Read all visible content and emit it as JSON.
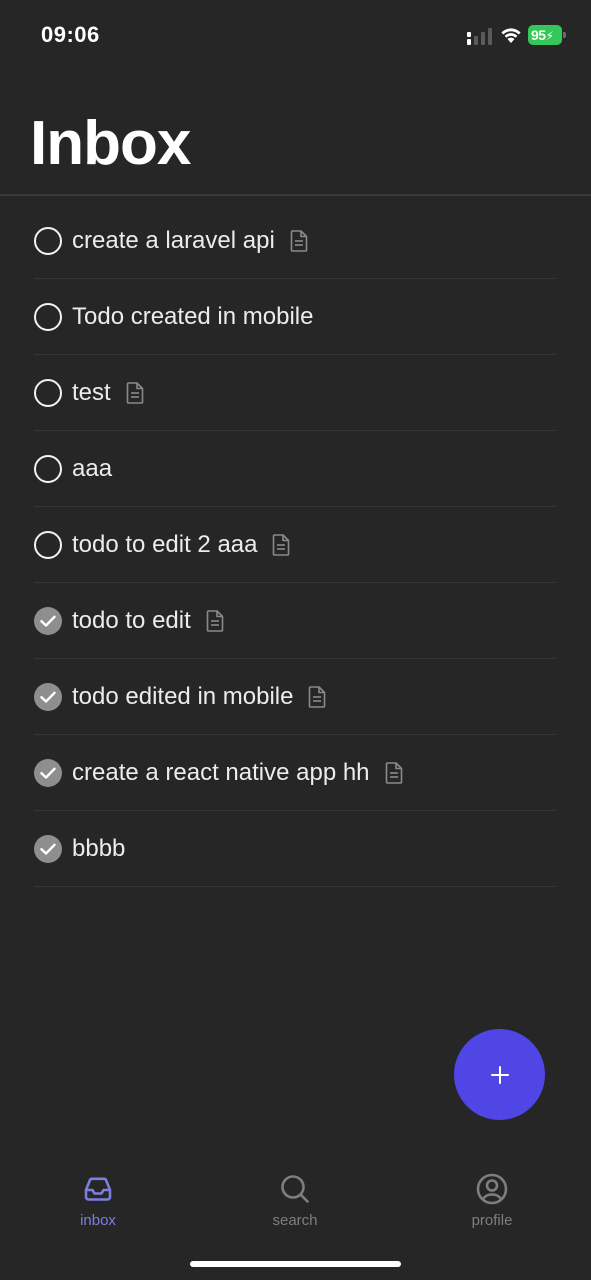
{
  "status_bar": {
    "time": "09:06",
    "battery": "95",
    "icons": [
      "signal-icon",
      "wifi-icon",
      "battery-charging-icon"
    ],
    "battery_color": "#34c759"
  },
  "header": {
    "title": "Inbox"
  },
  "todos": [
    {
      "title": "create a laravel api",
      "completed": false,
      "has_note": true
    },
    {
      "title": "Todo created in mobile",
      "completed": false,
      "has_note": false
    },
    {
      "title": "test",
      "completed": false,
      "has_note": true
    },
    {
      "title": "aaa",
      "completed": false,
      "has_note": false
    },
    {
      "title": "todo to edit 2 aaa",
      "completed": false,
      "has_note": true
    },
    {
      "title": "todo to edit",
      "completed": true,
      "has_note": true
    },
    {
      "title": "todo edited in mobile",
      "completed": true,
      "has_note": true
    },
    {
      "title": "create a react native app hh",
      "completed": true,
      "has_note": true
    },
    {
      "title": "bbbb",
      "completed": true,
      "has_note": false
    }
  ],
  "fab": {
    "icon": "plus-icon",
    "color": "#4f46e5"
  },
  "tab_bar": {
    "tabs": [
      {
        "label": "inbox",
        "icon": "inbox-icon",
        "active": true
      },
      {
        "label": "search",
        "icon": "search-icon",
        "active": false
      },
      {
        "label": "profile",
        "icon": "profile-icon",
        "active": false
      }
    ],
    "active_color": "#7c7fe0",
    "inactive_color": "#7e7e7e"
  },
  "colors": {
    "background": "#262626",
    "text": "#ececec",
    "completed_check": "#8e8e8e"
  }
}
